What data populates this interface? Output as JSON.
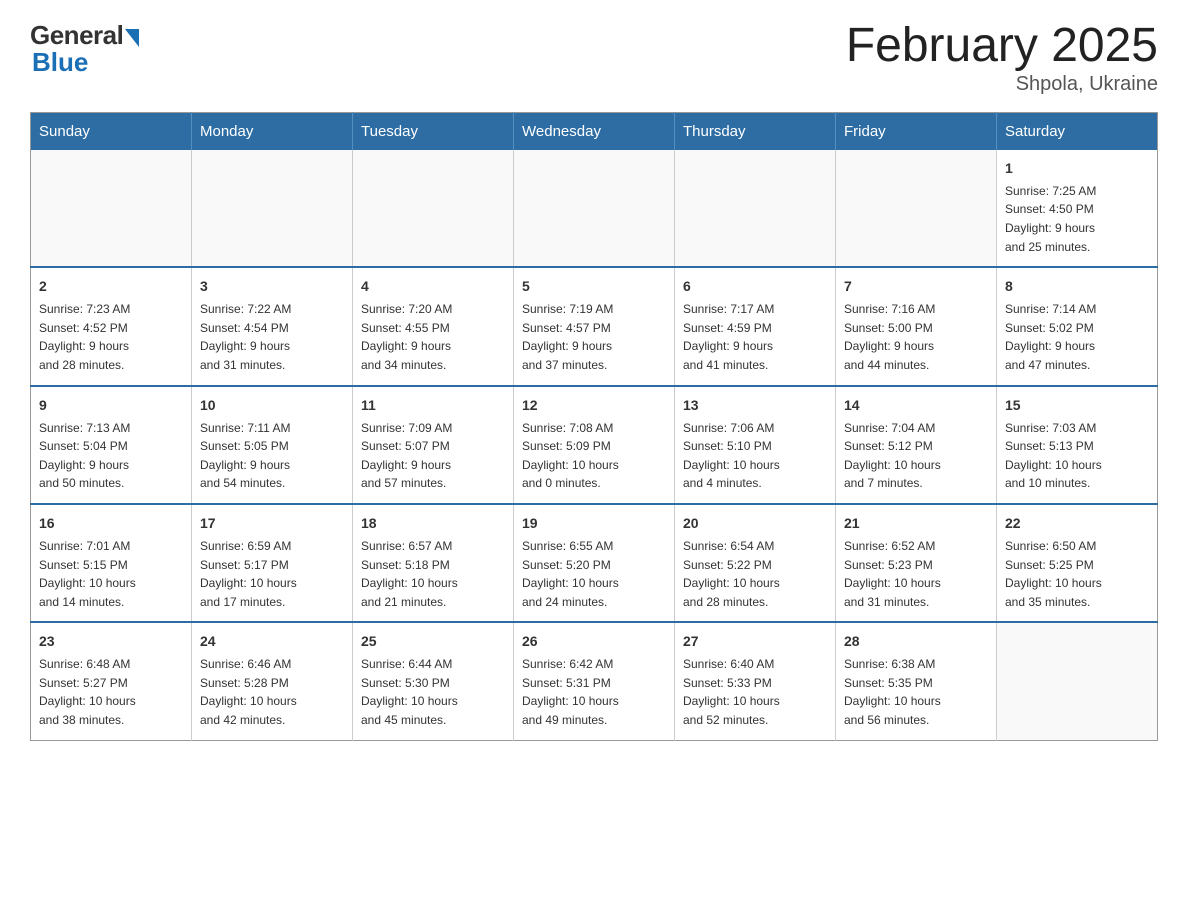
{
  "logo": {
    "general": "General",
    "blue": "Blue"
  },
  "title": "February 2025",
  "subtitle": "Shpola, Ukraine",
  "days_header": [
    "Sunday",
    "Monday",
    "Tuesday",
    "Wednesday",
    "Thursday",
    "Friday",
    "Saturday"
  ],
  "weeks": [
    [
      {
        "day": "",
        "info": ""
      },
      {
        "day": "",
        "info": ""
      },
      {
        "day": "",
        "info": ""
      },
      {
        "day": "",
        "info": ""
      },
      {
        "day": "",
        "info": ""
      },
      {
        "day": "",
        "info": ""
      },
      {
        "day": "1",
        "info": "Sunrise: 7:25 AM\nSunset: 4:50 PM\nDaylight: 9 hours\nand 25 minutes."
      }
    ],
    [
      {
        "day": "2",
        "info": "Sunrise: 7:23 AM\nSunset: 4:52 PM\nDaylight: 9 hours\nand 28 minutes."
      },
      {
        "day": "3",
        "info": "Sunrise: 7:22 AM\nSunset: 4:54 PM\nDaylight: 9 hours\nand 31 minutes."
      },
      {
        "day": "4",
        "info": "Sunrise: 7:20 AM\nSunset: 4:55 PM\nDaylight: 9 hours\nand 34 minutes."
      },
      {
        "day": "5",
        "info": "Sunrise: 7:19 AM\nSunset: 4:57 PM\nDaylight: 9 hours\nand 37 minutes."
      },
      {
        "day": "6",
        "info": "Sunrise: 7:17 AM\nSunset: 4:59 PM\nDaylight: 9 hours\nand 41 minutes."
      },
      {
        "day": "7",
        "info": "Sunrise: 7:16 AM\nSunset: 5:00 PM\nDaylight: 9 hours\nand 44 minutes."
      },
      {
        "day": "8",
        "info": "Sunrise: 7:14 AM\nSunset: 5:02 PM\nDaylight: 9 hours\nand 47 minutes."
      }
    ],
    [
      {
        "day": "9",
        "info": "Sunrise: 7:13 AM\nSunset: 5:04 PM\nDaylight: 9 hours\nand 50 minutes."
      },
      {
        "day": "10",
        "info": "Sunrise: 7:11 AM\nSunset: 5:05 PM\nDaylight: 9 hours\nand 54 minutes."
      },
      {
        "day": "11",
        "info": "Sunrise: 7:09 AM\nSunset: 5:07 PM\nDaylight: 9 hours\nand 57 minutes."
      },
      {
        "day": "12",
        "info": "Sunrise: 7:08 AM\nSunset: 5:09 PM\nDaylight: 10 hours\nand 0 minutes."
      },
      {
        "day": "13",
        "info": "Sunrise: 7:06 AM\nSunset: 5:10 PM\nDaylight: 10 hours\nand 4 minutes."
      },
      {
        "day": "14",
        "info": "Sunrise: 7:04 AM\nSunset: 5:12 PM\nDaylight: 10 hours\nand 7 minutes."
      },
      {
        "day": "15",
        "info": "Sunrise: 7:03 AM\nSunset: 5:13 PM\nDaylight: 10 hours\nand 10 minutes."
      }
    ],
    [
      {
        "day": "16",
        "info": "Sunrise: 7:01 AM\nSunset: 5:15 PM\nDaylight: 10 hours\nand 14 minutes."
      },
      {
        "day": "17",
        "info": "Sunrise: 6:59 AM\nSunset: 5:17 PM\nDaylight: 10 hours\nand 17 minutes."
      },
      {
        "day": "18",
        "info": "Sunrise: 6:57 AM\nSunset: 5:18 PM\nDaylight: 10 hours\nand 21 minutes."
      },
      {
        "day": "19",
        "info": "Sunrise: 6:55 AM\nSunset: 5:20 PM\nDaylight: 10 hours\nand 24 minutes."
      },
      {
        "day": "20",
        "info": "Sunrise: 6:54 AM\nSunset: 5:22 PM\nDaylight: 10 hours\nand 28 minutes."
      },
      {
        "day": "21",
        "info": "Sunrise: 6:52 AM\nSunset: 5:23 PM\nDaylight: 10 hours\nand 31 minutes."
      },
      {
        "day": "22",
        "info": "Sunrise: 6:50 AM\nSunset: 5:25 PM\nDaylight: 10 hours\nand 35 minutes."
      }
    ],
    [
      {
        "day": "23",
        "info": "Sunrise: 6:48 AM\nSunset: 5:27 PM\nDaylight: 10 hours\nand 38 minutes."
      },
      {
        "day": "24",
        "info": "Sunrise: 6:46 AM\nSunset: 5:28 PM\nDaylight: 10 hours\nand 42 minutes."
      },
      {
        "day": "25",
        "info": "Sunrise: 6:44 AM\nSunset: 5:30 PM\nDaylight: 10 hours\nand 45 minutes."
      },
      {
        "day": "26",
        "info": "Sunrise: 6:42 AM\nSunset: 5:31 PM\nDaylight: 10 hours\nand 49 minutes."
      },
      {
        "day": "27",
        "info": "Sunrise: 6:40 AM\nSunset: 5:33 PM\nDaylight: 10 hours\nand 52 minutes."
      },
      {
        "day": "28",
        "info": "Sunrise: 6:38 AM\nSunset: 5:35 PM\nDaylight: 10 hours\nand 56 minutes."
      },
      {
        "day": "",
        "info": ""
      }
    ]
  ]
}
